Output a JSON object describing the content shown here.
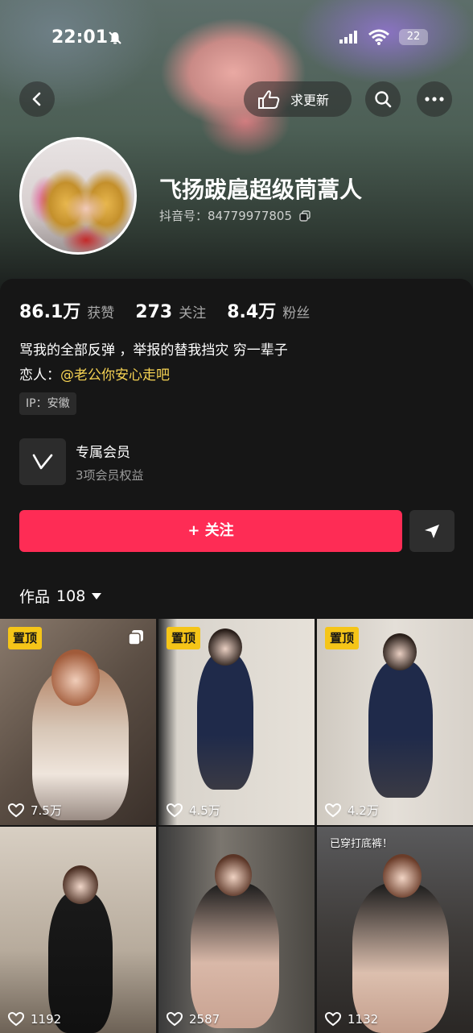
{
  "status_bar": {
    "time": "22:01",
    "battery": "22"
  },
  "header": {
    "update_label": "求更新"
  },
  "profile": {
    "name": "飞扬跋扈超级茼蒿人",
    "douyin_id_label": "抖音号：",
    "douyin_id": "84779977805"
  },
  "stats": [
    {
      "value": "86.1万",
      "label": "获赞"
    },
    {
      "value": "273",
      "label": "关注"
    },
    {
      "value": "8.4万",
      "label": "粉丝"
    }
  ],
  "bio": {
    "line1": "骂我的全部反弹 ，举报的替我挡灾 穷一辈子",
    "line2_prefix": "恋人：",
    "line2_mention": "@老公你安心走吧"
  },
  "ip_tag": "IP：安徽",
  "membership": {
    "title": "专属会员",
    "subtitle": "3项会员权益"
  },
  "follow_button": "+ 关注",
  "works": {
    "label": "作品",
    "count": "108"
  },
  "videos": [
    {
      "pinned": "置顶",
      "likes": "7.5万"
    },
    {
      "pinned": "置顶",
      "likes": "4.5万"
    },
    {
      "pinned": "置顶",
      "likes": "4.2万"
    },
    {
      "pinned": "",
      "likes": "1192"
    },
    {
      "pinned": "",
      "likes": "2587"
    },
    {
      "pinned": "",
      "likes": "1132",
      "caption": "已穿打底裤！"
    }
  ]
}
